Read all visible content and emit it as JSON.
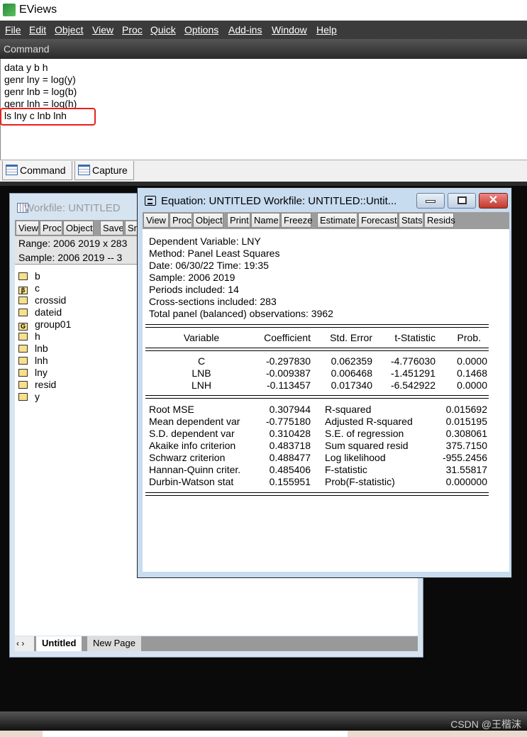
{
  "app": {
    "title": "EViews",
    "icon": "eviews-logo-icon"
  },
  "menu": [
    "File",
    "Edit",
    "Object",
    "View",
    "Proc",
    "Quick",
    "Options",
    "Add-ins",
    "Window",
    "Help"
  ],
  "command": {
    "header": "Command",
    "lines": [
      "data y b h",
      "genr lny = log(y)",
      "genr lnb = log(b)",
      "genr lnh = log(h)",
      "ls lny c lnb lnh"
    ],
    "highlight_color": "#e8201c"
  },
  "bottom_tabs": [
    "Command",
    "Capture"
  ],
  "workfile": {
    "title": "Workfile: UNTITLED",
    "toolbar": [
      "View",
      "Proc",
      "Object",
      "Save",
      "Sn"
    ],
    "range": "Range:   2006 2019 x 283",
    "sample": "Sample: 2006 2019    --    3",
    "objects": [
      {
        "name": "b",
        "type": "series"
      },
      {
        "name": "c",
        "type": "coef"
      },
      {
        "name": "crossid",
        "type": "series"
      },
      {
        "name": "dateid",
        "type": "series"
      },
      {
        "name": "group01",
        "type": "group"
      },
      {
        "name": "h",
        "type": "series"
      },
      {
        "name": "lnb",
        "type": "series"
      },
      {
        "name": "lnh",
        "type": "series"
      },
      {
        "name": "lny",
        "type": "series"
      },
      {
        "name": "resid",
        "type": "series"
      },
      {
        "name": "y",
        "type": "series"
      }
    ],
    "nav": "‹ ›",
    "pages": [
      "Untitled",
      "New Page"
    ]
  },
  "equation": {
    "title": "Equation: UNTITLED   Workfile: UNTITLED::Untit...",
    "toolbar": [
      "View",
      "Proc",
      "Object",
      "Print",
      "Name",
      "Freeze",
      "Estimate",
      "Forecast",
      "Stats",
      "Resids"
    ],
    "header": [
      "Dependent Variable: LNY",
      "Method: Panel Least Squares",
      "Date: 06/30/22   Time: 19:35",
      "Sample: 2006 2019",
      "Periods included: 14",
      "Cross-sections included: 283",
      "Total panel (balanced) observations: 3962"
    ],
    "columns": [
      "Variable",
      "Coefficient",
      "Std. Error",
      "t-Statistic",
      "Prob."
    ],
    "rows": [
      [
        "C",
        "-0.297830",
        "0.062359",
        "-4.776030",
        "0.0000"
      ],
      [
        "LNB",
        "-0.009387",
        "0.006468",
        "-1.451291",
        "0.1468"
      ],
      [
        "LNH",
        "-0.113457",
        "0.017340",
        "-6.542922",
        "0.0000"
      ]
    ],
    "stats": [
      [
        "Root MSE",
        "0.307944",
        "R-squared",
        "0.015692"
      ],
      [
        "Mean dependent var",
        "-0.775180",
        "Adjusted R-squared",
        "0.015195"
      ],
      [
        "S.D. dependent var",
        "0.310428",
        "S.E. of regression",
        "0.308061"
      ],
      [
        "Akaike info criterion",
        "0.483718",
        "Sum squared resid",
        "375.7150"
      ],
      [
        "Schwarz criterion",
        "0.488477",
        "Log likelihood",
        "-955.2456"
      ],
      [
        "Hannan-Quinn criter.",
        "0.485406",
        "F-statistic",
        "31.55817"
      ],
      [
        "Durbin-Watson stat",
        "0.155951",
        "Prob(F-statistic)",
        "0.000000"
      ]
    ]
  },
  "watermark": "CSDN @王楷沫"
}
